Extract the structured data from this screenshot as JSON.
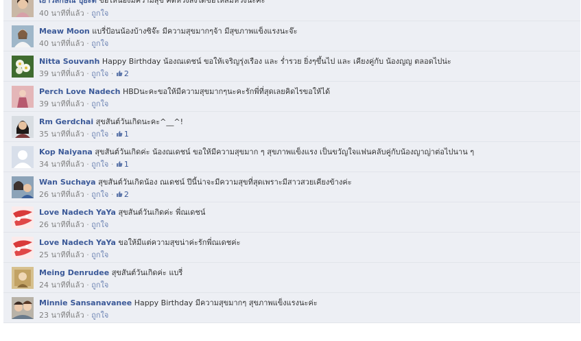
{
  "comments": [
    {
      "author": "เยาวลักษณ์ ปุยะติ",
      "text": "ขอให้น้องมีความสุข คิดหวังสิ่งใดขอให้สมหวังนะคะ",
      "time": "40 นาทีที่แล้ว",
      "like_label": "ถูกใจ",
      "likes": "",
      "avatar": "photo-woman-icon"
    },
    {
      "author": "Meaw Moon",
      "text": "แบรี่ป้อนน้องบ้างซิจ๊ะ มีความสุขมากๆจ้า มีสุขภาพแข็งแรงนะจ๊ะ",
      "time": "40 นาทีที่แล้ว",
      "like_label": "ถูกใจ",
      "likes": "",
      "avatar": "photo-portrait-icon"
    },
    {
      "author": "Nitta Souvanh",
      "text": "Happy Birthday น้องณเดชน์ ขอให้เจริญรุ่งเรือง และ ร่ำรวย ยิ่งๆขึ้นไป และ เคียงคู่กับ น้องญญ ตลอดไปน่ะ",
      "time": "39 นาทีที่แล้ว",
      "like_label": "ถูกใจ",
      "likes": "2",
      "avatar": "flower-icon"
    },
    {
      "author": "Perch Love Nadech",
      "text": "HBDนะคะขอให้มีความสุขมากๆนะคะรักพี่ที่สุดเลยคิดไรขอให้ได้",
      "time": "39 นาทีที่แล้ว",
      "like_label": "ถูกใจ",
      "likes": "",
      "avatar": "photo-pink-icon"
    },
    {
      "author": "Rm Gerdchai",
      "text": "สุขสันต์วันเกิดนะคะ^__^!",
      "time": "35 นาทีที่แล้ว",
      "like_label": "ถูกใจ",
      "likes": "1",
      "avatar": "photo-woman-dark-icon"
    },
    {
      "author": "Kop Naiyana",
      "text": "สุขสันต์วันเกิดค่ะ น้องณเดชน์ ขอให้มีความสุขมาก ๆ สุขภาพแข็งแรง เป็นขวัญใจแฟนคลับคู่กับน้องญาญ่าต่อไปนาน ๆ",
      "time": "34 นาทีที่แล้ว",
      "like_label": "ถูกใจ",
      "likes": "1",
      "avatar": "default-avatar-icon"
    },
    {
      "author": "Wan Suchaya",
      "text": "สุขสันต์วันเกิดน้อง ณเดชน์ ปีนี้น่าจะมีความสุขที่สุดเพราะมีสาวสวยเคียงข้างค่ะ",
      "time": "26 นาทีที่แล้ว",
      "like_label": "ถูกใจ",
      "likes": "2",
      "avatar": "photo-couple-icon"
    },
    {
      "author": "Love Nadech YaYa",
      "text": "สุขสันต์วันเกิดค่ะ พี่ณเดชน์",
      "time": "26 นาทีที่แล้ว",
      "like_label": "ถูกใจ",
      "likes": "",
      "avatar": "cartoon-red-icon"
    },
    {
      "author": "Love Nadech YaYa",
      "text": "ขอให้มีแต่ความสุขน่าค่ะรักพี่ณเดชค่ะ",
      "time": "25 นาทีที่แล้ว",
      "like_label": "ถูกใจ",
      "likes": "",
      "avatar": "cartoon-red-icon"
    },
    {
      "author": "Meing Denrudee",
      "text": "สุขสันต์วันเกิดค่ะ แบรี่",
      "time": "24 นาทีที่แล้ว",
      "like_label": "ถูกใจ",
      "likes": "",
      "avatar": "photo-tan-icon"
    },
    {
      "author": "Minnie Sansanavanee",
      "text": "Happy Birthday มีความสุขมากๆ สุขภาพแข็งแรงนะค่ะ",
      "time": "23 นาทีที่แล้ว",
      "like_label": "ถูกใจ",
      "likes": "",
      "avatar": "photo-friends-icon"
    }
  ],
  "colors": {
    "author": "#3b5998",
    "row_background": "#edeff4",
    "meta": "#808080"
  }
}
